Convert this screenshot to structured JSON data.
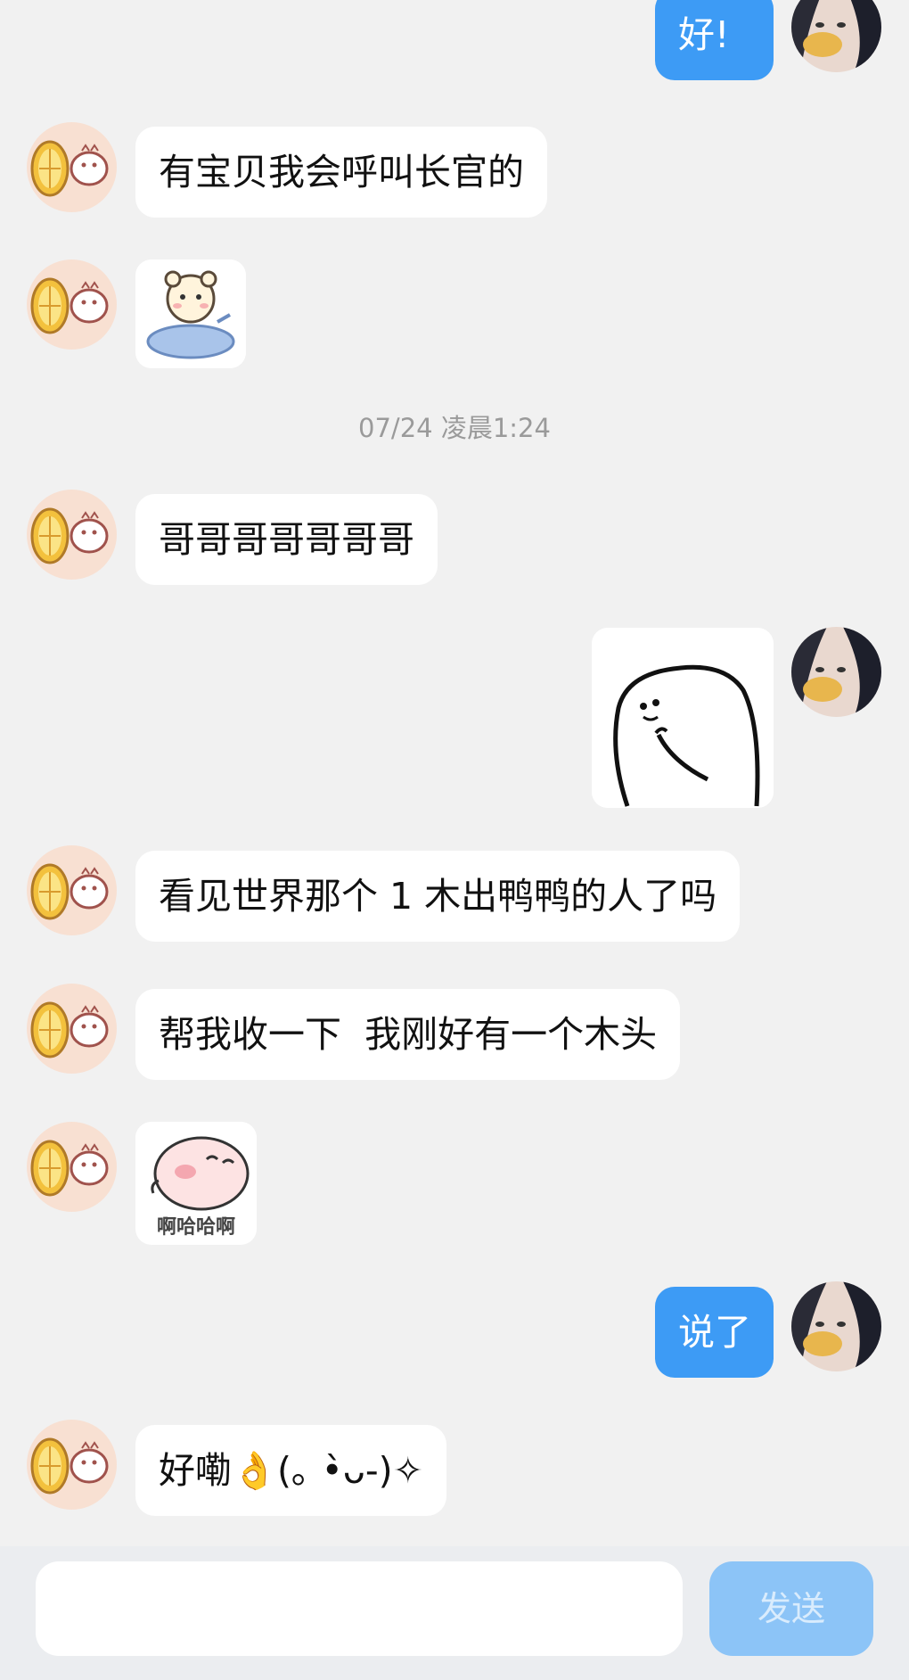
{
  "messages": {
    "m1": "好!",
    "m2": "有宝贝我会呼叫长官的",
    "m4": "哥哥哥哥哥哥哥",
    "m6": "看见世界那个 1 木出鸭鸭的人了吗",
    "m7": "帮我收一下  我刚好有一个木头",
    "m9": "说了",
    "m10": "好嘞👌(｡ •̀ᴗ-)✧"
  },
  "timestamp": "07/24 凌晨1:24",
  "sticker_pig_caption": "啊哈哈啊",
  "input": {
    "placeholder": "",
    "send_label": "发送"
  },
  "colors": {
    "background": "#f1f1f1",
    "outgoing_bubble": "#3d9bf5",
    "incoming_bubble": "#ffffff",
    "send_button": "#8cc4f7"
  }
}
